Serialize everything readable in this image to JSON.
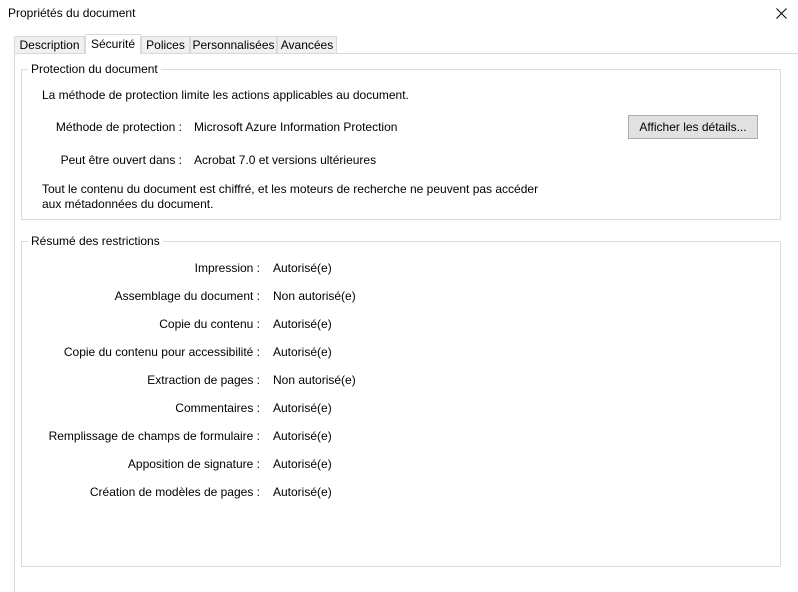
{
  "window": {
    "title": "Propriétés du document"
  },
  "tabs": [
    {
      "label": "Description"
    },
    {
      "label": "Sécurité"
    },
    {
      "label": "Polices"
    },
    {
      "label": "Personnalisées"
    },
    {
      "label": "Avancées"
    }
  ],
  "active_tab": "Sécurité",
  "protection": {
    "group_title": "Protection du document",
    "intro": "La méthode de protection limite les actions applicables au document.",
    "method_label": "Méthode de protection :",
    "method_value": "Microsoft Azure Information Protection",
    "opens_label": "Peut être ouvert dans :",
    "opens_value": "Acrobat 7.0 et versions ultérieures",
    "details_button": "Afficher les détails...",
    "note_line1": "Tout le contenu du document est chiffré, et les moteurs de recherche ne peuvent pas accéder",
    "note_line2": "aux métadonnées du document."
  },
  "restrictions": {
    "group_title": "Résumé des restrictions",
    "rows": [
      {
        "label": "Impression :",
        "value": "Autorisé(e)"
      },
      {
        "label": "Assemblage du document :",
        "value": "Non autorisé(e)"
      },
      {
        "label": "Copie du contenu :",
        "value": "Autorisé(e)"
      },
      {
        "label": "Copie du contenu pour accessibilité :",
        "value": "Autorisé(e)"
      },
      {
        "label": "Extraction de pages :",
        "value": "Non autorisé(e)"
      },
      {
        "label": "Commentaires :",
        "value": "Autorisé(e)"
      },
      {
        "label": "Remplissage de champs de formulaire :",
        "value": "Autorisé(e)"
      },
      {
        "label": "Apposition de signature :",
        "value": "Autorisé(e)"
      },
      {
        "label": "Création de modèles de pages :",
        "value": "Autorisé(e)"
      }
    ]
  }
}
